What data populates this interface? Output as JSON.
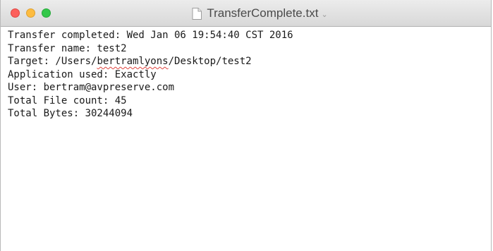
{
  "window": {
    "title": "TransferComplete.txt",
    "title_chevron": "⌄",
    "icons": {
      "close": "close-button",
      "minimize": "minimize-button",
      "zoom": "zoom-button",
      "document": "document-icon"
    }
  },
  "document": {
    "line1": "Transfer completed: Wed Jan 06 19:54:40 CST 2016",
    "line2": "Transfer name: test2",
    "line3": {
      "prefix": "Target: /Users/",
      "misspelled": "bertramlyons",
      "suffix": "/Desktop/test2"
    },
    "line4": "Application used: Exactly",
    "line5": "User: bertram@avpreserve.com",
    "line6": "Total File count: 45",
    "line7": "Total Bytes: 30244094"
  },
  "colors": {
    "close": "#fc605c",
    "minimize": "#fdbc40",
    "zoom": "#34c84a",
    "spellcheck": "#e0443e"
  }
}
